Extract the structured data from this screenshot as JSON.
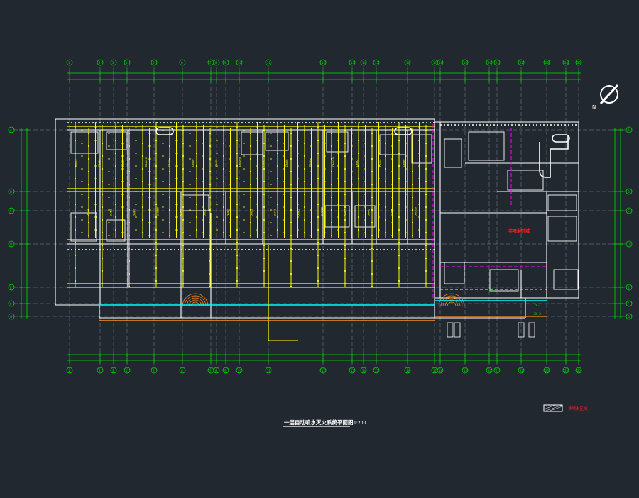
{
  "drawing": {
    "title_text": "一层自动喷水灭火系统平面图",
    "scale_text": "1:200",
    "legend_text": "非喷淋区域",
    "north_label": "N",
    "note_left_text": "",
    "colors": {
      "background": "#212830",
      "dim": "#00e000",
      "wall": "#ffffff",
      "pipe": "#ffff00",
      "water": "#00ffff",
      "magenta": "#ff00ff",
      "orange": "#ff8c1a",
      "red": "#ff2020",
      "grid": "#9aa0a6"
    },
    "axis_labels_top": [
      "1",
      "2",
      "3",
      "4",
      "5",
      "6",
      "7",
      "8",
      "9",
      "10",
      "11",
      "12",
      "13",
      "14",
      "15",
      "16",
      "17",
      "18",
      "19",
      "20",
      "21",
      "22",
      "23",
      "24",
      "25",
      "26",
      "27",
      "28"
    ],
    "axis_labels_side": [
      "A",
      "B",
      "C",
      "D",
      "E",
      "F",
      "G"
    ],
    "pipe_labels": [
      "DN25",
      "DN32",
      "DN40",
      "DN50",
      "DN65",
      "DN80",
      "DN100",
      "DN150",
      "DN25",
      "DN32",
      "DN40",
      "DN50",
      "DN65",
      "DN80",
      "DN100",
      "DN25",
      "DN32",
      "DN40",
      "DN50",
      "DN65",
      "DN80",
      "DN100",
      "DN150",
      "DN25",
      "DN32",
      "DN40",
      "DN50",
      "DN65",
      "DN80",
      "DN100"
    ],
    "room_labels": [
      "SL",
      "ZL-1",
      "ZL-2"
    ]
  }
}
